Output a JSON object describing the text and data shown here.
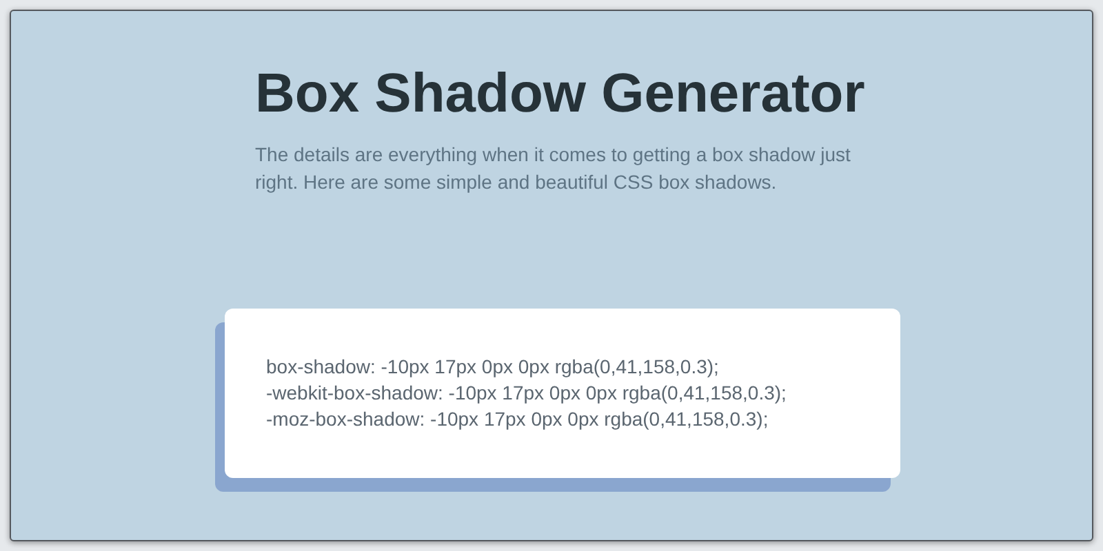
{
  "header": {
    "title": "Box Shadow Generator",
    "description": "The details are everything when it comes to getting a box shadow just right. Here are some simple and beautiful CSS box shadows."
  },
  "code_lines": [
    "box-shadow: -10px 17px 0px 0px rgba(0,41,158,0.3);",
    "-webkit-box-shadow: -10px 17px 0px 0px rgba(0,41,158,0.3);",
    "-moz-box-shadow: -10px 17px 0px 0px rgba(0,41,158,0.3);"
  ]
}
